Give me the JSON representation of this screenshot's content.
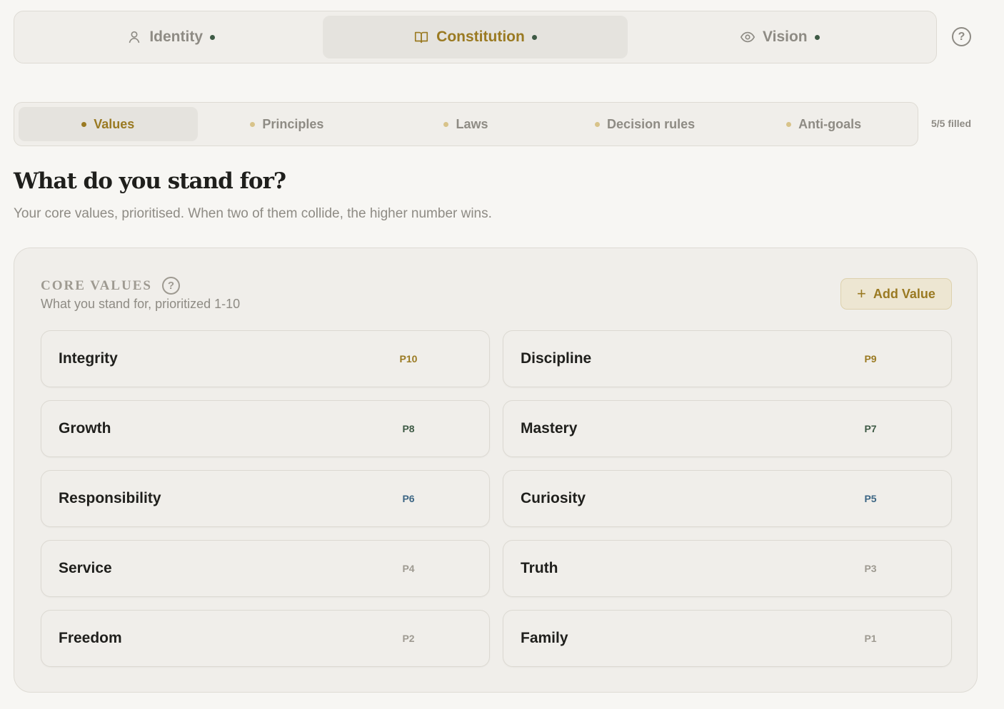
{
  "top_tabs": [
    {
      "label": "Identity",
      "icon": "user-icon",
      "active": false
    },
    {
      "label": "Constitution",
      "icon": "book-icon",
      "active": true
    },
    {
      "label": "Vision",
      "icon": "eye-icon",
      "active": false
    }
  ],
  "sub_tabs": [
    {
      "label": "Values",
      "active": true
    },
    {
      "label": "Principles",
      "active": false
    },
    {
      "label": "Laws",
      "active": false
    },
    {
      "label": "Decision rules",
      "active": false
    },
    {
      "label": "Anti-goals",
      "active": false
    }
  ],
  "filled_status": "5/5 filled",
  "page": {
    "title": "What do you stand for?",
    "subtitle": "Your core values, prioritised. When two of them collide, the higher number wins."
  },
  "card": {
    "title": "CORE VALUES",
    "subtitle": "What you stand for, prioritized 1-10",
    "add_label": "Add Value",
    "help_glyph": "?"
  },
  "values": [
    {
      "name": "Integrity",
      "priority": "P10",
      "color": "#9a7a22"
    },
    {
      "name": "Discipline",
      "priority": "P9",
      "color": "#9a7a22"
    },
    {
      "name": "Growth",
      "priority": "P8",
      "color": "#3e5a45"
    },
    {
      "name": "Mastery",
      "priority": "P7",
      "color": "#3e5a45"
    },
    {
      "name": "Responsibility",
      "priority": "P6",
      "color": "#3d6684"
    },
    {
      "name": "Curiosity",
      "priority": "P5",
      "color": "#3d6684"
    },
    {
      "name": "Service",
      "priority": "P4",
      "color": "#9e9a91"
    },
    {
      "name": "Truth",
      "priority": "P3",
      "color": "#9e9a91"
    },
    {
      "name": "Freedom",
      "priority": "P2",
      "color": "#9e9a91"
    },
    {
      "name": "Family",
      "priority": "P1",
      "color": "#9e9a91"
    }
  ],
  "colors": {
    "accent": "#9a7a22",
    "status_dot": "#3e5a45",
    "background": "#f7f6f3"
  }
}
